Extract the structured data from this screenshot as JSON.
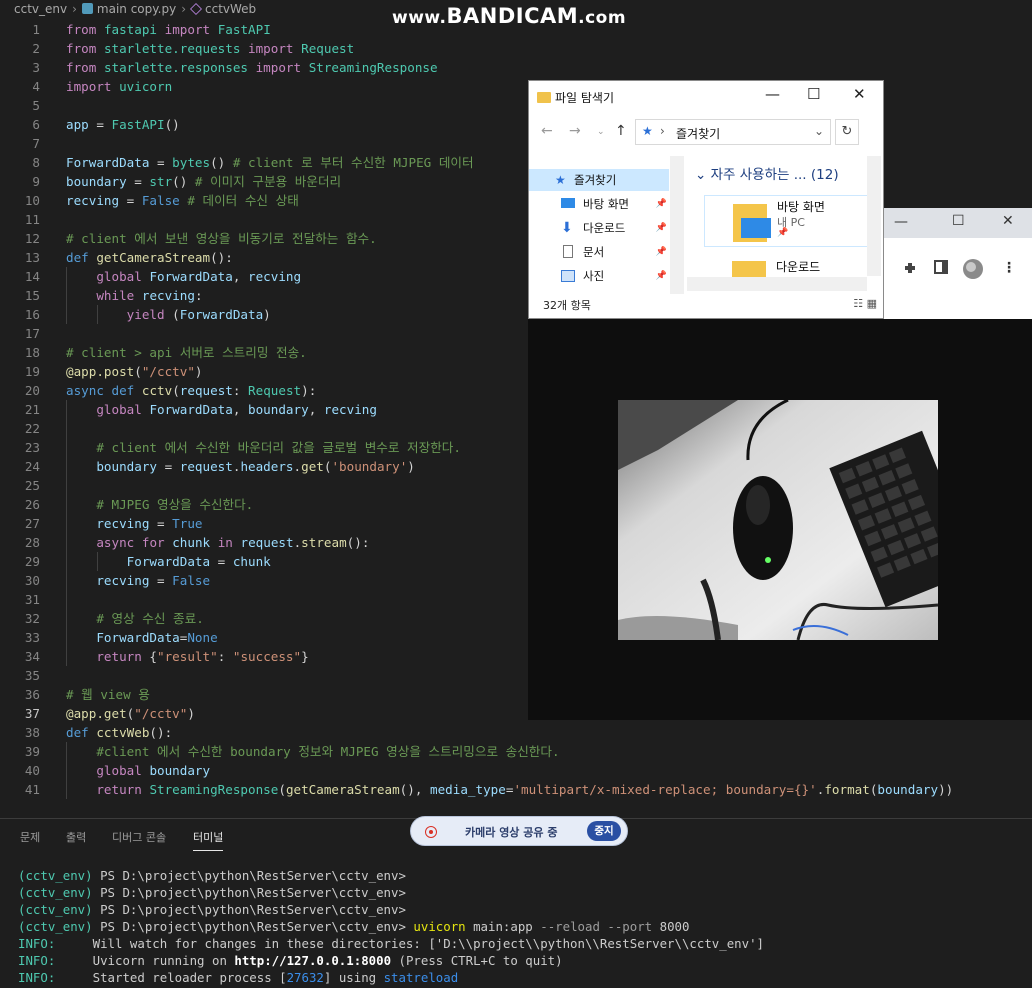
{
  "breadcrumb": {
    "folder": "cctv_env",
    "file": "main copy.py",
    "symbol": "cctvWeb"
  },
  "watermark": {
    "prefix": "www.",
    "brand": "BANDICAM",
    "suffix": ".com"
  },
  "editor": {
    "active_line": 37,
    "lines": [
      {
        "n": "1"
      },
      {
        "n": "2"
      },
      {
        "n": "3"
      },
      {
        "n": "4"
      },
      {
        "n": "5"
      },
      {
        "n": "6"
      },
      {
        "n": "7"
      },
      {
        "n": "8"
      },
      {
        "n": "9"
      },
      {
        "n": "10"
      },
      {
        "n": "11"
      },
      {
        "n": "12"
      },
      {
        "n": "13"
      },
      {
        "n": "14"
      },
      {
        "n": "15"
      },
      {
        "n": "16"
      },
      {
        "n": "17"
      },
      {
        "n": "18"
      },
      {
        "n": "19"
      },
      {
        "n": "20"
      },
      {
        "n": "21"
      },
      {
        "n": "22"
      },
      {
        "n": "23"
      },
      {
        "n": "24"
      },
      {
        "n": "25"
      },
      {
        "n": "26"
      },
      {
        "n": "27"
      },
      {
        "n": "28"
      },
      {
        "n": "29"
      },
      {
        "n": "30"
      },
      {
        "n": "31"
      },
      {
        "n": "32"
      },
      {
        "n": "33"
      },
      {
        "n": "34"
      },
      {
        "n": "35"
      },
      {
        "n": "36"
      },
      {
        "n": "37"
      },
      {
        "n": "38"
      },
      {
        "n": "39"
      },
      {
        "n": "40"
      },
      {
        "n": "41"
      }
    ],
    "code": [
      [
        [
          "k",
          "from"
        ],
        [
          "o",
          " "
        ],
        [
          "c",
          "fastapi"
        ],
        [
          "o",
          " "
        ],
        [
          "k",
          "import"
        ],
        [
          "o",
          " "
        ],
        [
          "c",
          "FastAPI"
        ]
      ],
      [
        [
          "k",
          "from"
        ],
        [
          "o",
          " "
        ],
        [
          "c",
          "starlette.requests"
        ],
        [
          "o",
          " "
        ],
        [
          "k",
          "import"
        ],
        [
          "o",
          " "
        ],
        [
          "c",
          "Request"
        ]
      ],
      [
        [
          "k",
          "from"
        ],
        [
          "o",
          " "
        ],
        [
          "c",
          "starlette.responses"
        ],
        [
          "o",
          " "
        ],
        [
          "k",
          "import"
        ],
        [
          "o",
          " "
        ],
        [
          "c",
          "StreamingResponse"
        ]
      ],
      [
        [
          "k",
          "import"
        ],
        [
          "o",
          " "
        ],
        [
          "c",
          "uvicorn"
        ]
      ],
      [],
      [
        [
          "v",
          "app"
        ],
        [
          "o",
          " = "
        ],
        [
          "c",
          "FastAPI"
        ],
        [
          "o",
          "()"
        ]
      ],
      [],
      [
        [
          "v",
          "ForwardData"
        ],
        [
          "o",
          " = "
        ],
        [
          "c",
          "bytes"
        ],
        [
          "o",
          "() "
        ],
        [
          "m",
          "# client 로 부터 수신한 MJPEG 데이터"
        ]
      ],
      [
        [
          "v",
          "boundary"
        ],
        [
          "o",
          " = "
        ],
        [
          "c",
          "str"
        ],
        [
          "o",
          "() "
        ],
        [
          "m",
          "# 이미지 구분용 바운더리"
        ]
      ],
      [
        [
          "v",
          "recving"
        ],
        [
          "o",
          " = "
        ],
        [
          "b",
          "False"
        ],
        [
          "o",
          " "
        ],
        [
          "m",
          "# 데이터 수신 상태"
        ]
      ],
      [],
      [
        [
          "m",
          "# client 에서 보낸 영상을 비동기로 전달하는 함수."
        ]
      ],
      [
        [
          "b",
          "def"
        ],
        [
          "o",
          " "
        ],
        [
          "f",
          "getCameraStream"
        ],
        [
          "o",
          "():"
        ]
      ],
      [
        [
          "o",
          "    "
        ],
        [
          "k",
          "global"
        ],
        [
          "o",
          " "
        ],
        [
          "v",
          "ForwardData"
        ],
        [
          "o",
          ", "
        ],
        [
          "v",
          "recving"
        ]
      ],
      [
        [
          "o",
          "    "
        ],
        [
          "k",
          "while"
        ],
        [
          "o",
          " "
        ],
        [
          "v",
          "recving"
        ],
        [
          "o",
          ":"
        ]
      ],
      [
        [
          "o",
          "        "
        ],
        [
          "k",
          "yield"
        ],
        [
          "o",
          " ("
        ],
        [
          "v",
          "ForwardData"
        ],
        [
          "o",
          ")"
        ]
      ],
      [],
      [
        [
          "m",
          "# client > api 서버로 스트리밍 전송."
        ]
      ],
      [
        [
          "d",
          "@app.post"
        ],
        [
          "o",
          "("
        ],
        [
          "s",
          "\"/cctv\""
        ],
        [
          "o",
          ")"
        ]
      ],
      [
        [
          "b",
          "async"
        ],
        [
          "o",
          " "
        ],
        [
          "b",
          "def"
        ],
        [
          "o",
          " "
        ],
        [
          "f",
          "cctv"
        ],
        [
          "o",
          "("
        ],
        [
          "v",
          "request"
        ],
        [
          "o",
          ": "
        ],
        [
          "c",
          "Request"
        ],
        [
          "o",
          "):"
        ]
      ],
      [
        [
          "o",
          "    "
        ],
        [
          "k",
          "global"
        ],
        [
          "o",
          " "
        ],
        [
          "v",
          "ForwardData"
        ],
        [
          "o",
          ", "
        ],
        [
          "v",
          "boundary"
        ],
        [
          "o",
          ", "
        ],
        [
          "v",
          "recving"
        ]
      ],
      [],
      [
        [
          "o",
          "    "
        ],
        [
          "m",
          "# client 에서 수신한 바운더리 값을 글로벌 변수로 저장한다."
        ]
      ],
      [
        [
          "o",
          "    "
        ],
        [
          "v",
          "boundary"
        ],
        [
          "o",
          " = "
        ],
        [
          "v",
          "request"
        ],
        [
          "o",
          "."
        ],
        [
          "v",
          "headers"
        ],
        [
          "o",
          "."
        ],
        [
          "f",
          "get"
        ],
        [
          "o",
          "("
        ],
        [
          "s",
          "'boundary'"
        ],
        [
          "o",
          ")"
        ]
      ],
      [],
      [
        [
          "o",
          "    "
        ],
        [
          "m",
          "# MJPEG 영상을 수신한다."
        ]
      ],
      [
        [
          "o",
          "    "
        ],
        [
          "v",
          "recving"
        ],
        [
          "o",
          " = "
        ],
        [
          "b",
          "True"
        ]
      ],
      [
        [
          "o",
          "    "
        ],
        [
          "k",
          "async"
        ],
        [
          "o",
          " "
        ],
        [
          "k",
          "for"
        ],
        [
          "o",
          " "
        ],
        [
          "v",
          "chunk"
        ],
        [
          "o",
          " "
        ],
        [
          "k",
          "in"
        ],
        [
          "o",
          " "
        ],
        [
          "v",
          "request"
        ],
        [
          "o",
          "."
        ],
        [
          "f",
          "stream"
        ],
        [
          "o",
          "():"
        ]
      ],
      [
        [
          "o",
          "        "
        ],
        [
          "v",
          "ForwardData"
        ],
        [
          "o",
          " = "
        ],
        [
          "v",
          "chunk"
        ]
      ],
      [
        [
          "o",
          "    "
        ],
        [
          "v",
          "recving"
        ],
        [
          "o",
          " = "
        ],
        [
          "b",
          "False"
        ]
      ],
      [],
      [
        [
          "o",
          "    "
        ],
        [
          "m",
          "# 영상 수신 종료."
        ]
      ],
      [
        [
          "o",
          "    "
        ],
        [
          "v",
          "ForwardData"
        ],
        [
          "o",
          "="
        ],
        [
          "b",
          "None"
        ]
      ],
      [
        [
          "o",
          "    "
        ],
        [
          "k",
          "return"
        ],
        [
          "o",
          " {"
        ],
        [
          "s",
          "\"result\""
        ],
        [
          "o",
          ": "
        ],
        [
          "s",
          "\"success\""
        ],
        [
          "o",
          "}"
        ]
      ],
      [],
      [
        [
          "m",
          "# 웹 view 용"
        ]
      ],
      [
        [
          "d",
          "@app.get"
        ],
        [
          "o",
          "("
        ],
        [
          "s",
          "\"/cctv\""
        ],
        [
          "o",
          ")"
        ]
      ],
      [
        [
          "b",
          "def"
        ],
        [
          "o",
          " "
        ],
        [
          "f",
          "cctvWeb"
        ],
        [
          "o",
          "():"
        ]
      ],
      [
        [
          "o",
          "    "
        ],
        [
          "m",
          "#client 에서 수신한 boundary 정보와 MJPEG 영상을 스트리밍으로 송신한다."
        ]
      ],
      [
        [
          "o",
          "    "
        ],
        [
          "k",
          "global"
        ],
        [
          "o",
          " "
        ],
        [
          "v",
          "boundary"
        ]
      ],
      [
        [
          "o",
          "    "
        ],
        [
          "k",
          "return"
        ],
        [
          "o",
          " "
        ],
        [
          "c",
          "StreamingResponse"
        ],
        [
          "o",
          "("
        ],
        [
          "f",
          "getCameraStream"
        ],
        [
          "o",
          "(), "
        ],
        [
          "v",
          "media_type"
        ],
        [
          "o",
          "="
        ],
        [
          "s",
          "'multipart/x-mixed-replace; boundary={}'"
        ],
        [
          "o",
          "."
        ],
        [
          "f",
          "format"
        ],
        [
          "o",
          "("
        ],
        [
          "v",
          "boundary"
        ],
        [
          "o",
          "))"
        ]
      ]
    ]
  },
  "panel": {
    "tabs": [
      "문제",
      "출력",
      "디버그 콘솔",
      "터미널"
    ],
    "active_tab": "터미널"
  },
  "terminal": {
    "env": "(cctv_env)",
    "prompt": "PS D:\\project\\python\\RestServer\\cctv_env>",
    "cmd": "uvicorn",
    "app_arg": "main:app",
    "flags": "--reload --port",
    "port": "8000",
    "info_label": "INFO:",
    "info1": "Will watch for changes in these directories: ['D:\\\\project\\\\python\\\\RestServer\\\\cctv_env']",
    "info2_pre": "Uvicorn running on ",
    "info2_url": "http://127.0.0.1:8000",
    "info2_post": " (Press CTRL+C to quit)",
    "info3_pre": "Started reloader process [",
    "info3_pid": "27632",
    "info3_mid": "] using ",
    "info3_tool": "statreload"
  },
  "camera_pill": {
    "label": "카메라 영상 공유 중",
    "stop": "중지"
  },
  "explorer": {
    "title": "파일 탐색기",
    "address": "즐겨찾기",
    "section": "자주 사용하는 ... (12)",
    "nav": [
      {
        "label": "즐겨찾기",
        "icon": "star-icon"
      },
      {
        "label": "바탕 화면",
        "icon": "desktop-icon"
      },
      {
        "label": "다운로드",
        "icon": "download-icon"
      },
      {
        "label": "문서",
        "icon": "document-icon"
      },
      {
        "label": "사진",
        "icon": "picture-icon"
      }
    ],
    "items": [
      {
        "name": "바탕 화면",
        "sub": "내 PC"
      },
      {
        "name": "다운로드",
        "sub": ""
      }
    ],
    "status": "32개 항목"
  },
  "colors": {
    "editor_bg": "#1e1e1e",
    "keyword": "#c586c0",
    "class": "#4ec9b0",
    "string": "#ce9178",
    "comment": "#6a9955",
    "pill_button": "#2a4fa3"
  }
}
